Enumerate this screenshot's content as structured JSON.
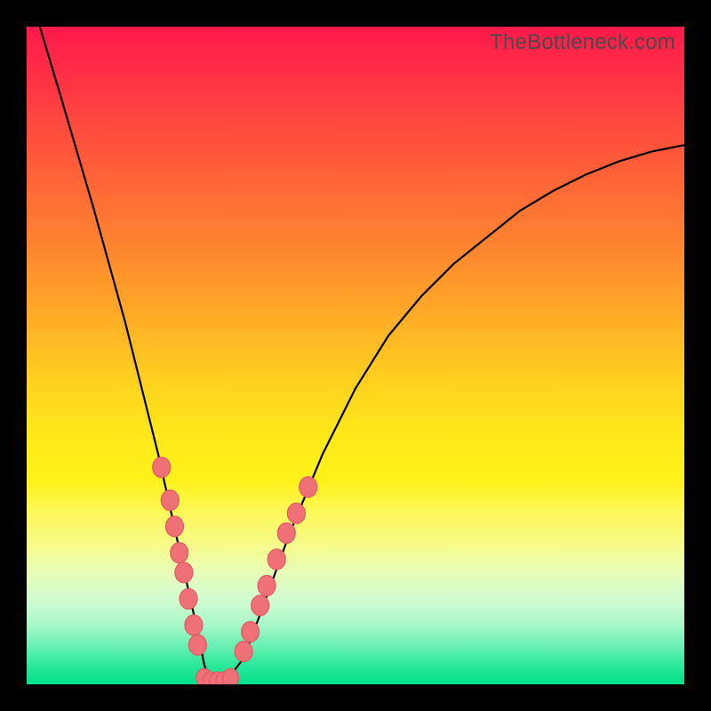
{
  "watermark": "TheBottleneck.com",
  "chart_data": {
    "type": "line",
    "title": "",
    "xlabel": "",
    "ylabel": "",
    "xlim": [
      0,
      100
    ],
    "ylim": [
      0,
      100
    ],
    "series": [
      {
        "name": "bottleneck-curve",
        "x": [
          2,
          5,
          10,
          15,
          20,
          22,
          24,
          26,
          27,
          28,
          29,
          30,
          33,
          36,
          40,
          45,
          50,
          55,
          60,
          65,
          70,
          75,
          80,
          85,
          90,
          95,
          100
        ],
        "values": [
          100,
          90,
          73,
          55,
          35,
          26,
          17,
          8,
          3,
          0,
          0,
          0,
          4,
          12,
          23,
          35,
          45,
          53,
          59,
          64,
          68,
          72,
          75,
          77.5,
          79.5,
          81,
          82
        ]
      }
    ],
    "data_points_left": [
      {
        "x": 20.5,
        "y": 33
      },
      {
        "x": 21.8,
        "y": 28
      },
      {
        "x": 22.5,
        "y": 24
      },
      {
        "x": 23.2,
        "y": 20
      },
      {
        "x": 23.9,
        "y": 17
      },
      {
        "x": 24.6,
        "y": 13
      },
      {
        "x": 25.4,
        "y": 9
      },
      {
        "x": 26.0,
        "y": 6
      }
    ],
    "data_points_bottom": [
      {
        "x": 27.0,
        "y": 1
      },
      {
        "x": 28.0,
        "y": 0.5
      },
      {
        "x": 29.0,
        "y": 0.5
      },
      {
        "x": 30.0,
        "y": 0.5
      },
      {
        "x": 31.0,
        "y": 1
      }
    ],
    "data_points_right": [
      {
        "x": 33.0,
        "y": 5
      },
      {
        "x": 34.0,
        "y": 8
      },
      {
        "x": 35.5,
        "y": 12
      },
      {
        "x": 36.5,
        "y": 15
      },
      {
        "x": 38.0,
        "y": 19
      },
      {
        "x": 39.5,
        "y": 23
      },
      {
        "x": 41.0,
        "y": 26
      },
      {
        "x": 42.8,
        "y": 30
      }
    ]
  }
}
